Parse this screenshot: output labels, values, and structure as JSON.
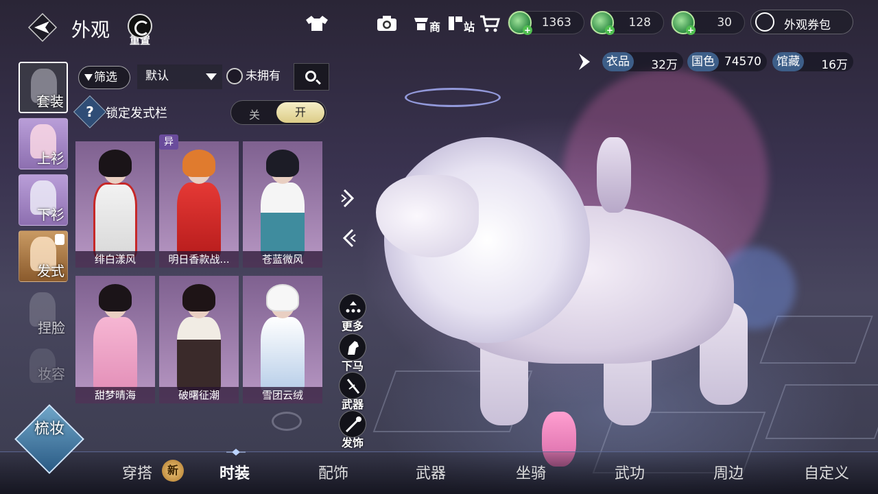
{
  "header": {
    "title": "外观",
    "reset_label": "重置",
    "shop_label": "商",
    "station_label": "站",
    "currencies": [
      {
        "value": "1363"
      },
      {
        "value": "128"
      },
      {
        "value": "30"
      }
    ],
    "wallet_label": "外观券包"
  },
  "stats": [
    {
      "key": "衣品",
      "value": "32万"
    },
    {
      "key": "国色",
      "value": "74570"
    },
    {
      "key": "馆藏",
      "value": "16万"
    }
  ],
  "left_tabs": [
    {
      "label": "套装"
    },
    {
      "label": "上衫"
    },
    {
      "label": "下衫"
    },
    {
      "label": "发式"
    },
    {
      "label": "捏脸"
    },
    {
      "label": "妆容"
    }
  ],
  "filter": {
    "filter_label": "筛选",
    "sort_value": "默认",
    "owned_label": "未拥有"
  },
  "lock_hair": {
    "label": "锁定发式栏",
    "off_label": "关",
    "on_label": "开"
  },
  "badge_yi": "异",
  "outfits": [
    {
      "name": "绯白漾风"
    },
    {
      "name": "明日香款战..."
    },
    {
      "name": "苍蓝微风"
    },
    {
      "name": "甜梦晴海"
    },
    {
      "name": "破曙征潮"
    },
    {
      "name": "雪团云绒"
    }
  ],
  "quick_actions": [
    {
      "label": "更多"
    },
    {
      "label": "下马"
    },
    {
      "label": "武器"
    },
    {
      "label": "发饰"
    }
  ],
  "makeup_label": "梳妆",
  "bottom_tabs": [
    {
      "label": "穿搭"
    },
    {
      "label": "时装"
    },
    {
      "label": "配饰"
    },
    {
      "label": "武器"
    },
    {
      "label": "坐骑"
    },
    {
      "label": "武功"
    },
    {
      "label": "周边"
    },
    {
      "label": "自定义"
    }
  ],
  "new_badge": "新",
  "colors": {
    "stat_key_bg": "#3d5e88",
    "toggle_on": "#dccc87",
    "card_bg": "#b898c4"
  }
}
